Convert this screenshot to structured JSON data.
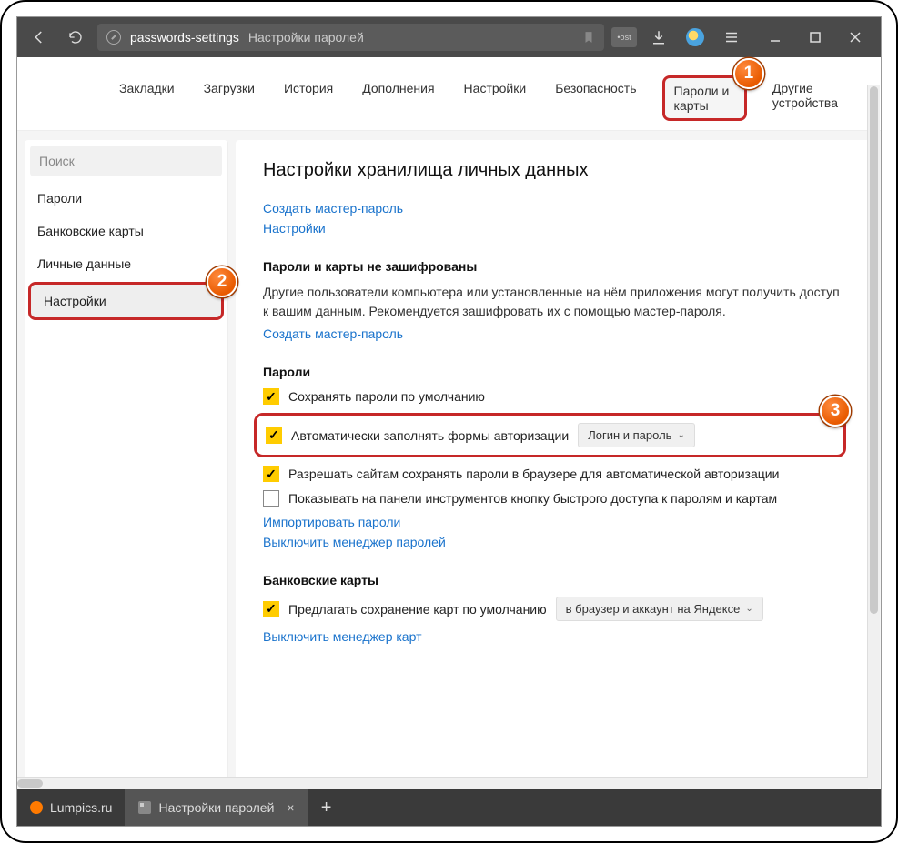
{
  "toolbar": {
    "url": "passwords-settings",
    "page_title": "Настройки паролей"
  },
  "topnav": {
    "items": [
      "Закладки",
      "Загрузки",
      "История",
      "Дополнения",
      "Настройки",
      "Безопасность",
      "Пароли и карты",
      "Другие устройства"
    ],
    "highlighted_index": 6
  },
  "sidebar": {
    "search_placeholder": "Поиск",
    "items": [
      "Пароли",
      "Банковские карты",
      "Личные данные",
      "Настройки"
    ],
    "highlighted_index": 3
  },
  "content": {
    "heading": "Настройки хранилища личных данных",
    "link_create_master": "Создать мастер-пароль",
    "link_settings": "Настройки",
    "enc_section": {
      "title": "Пароли и карты не зашифрованы",
      "desc": "Другие пользователи компьютера или установленные на нём приложения могут получить доступ к вашим данным. Рекомендуется зашифровать их с помощью мастер-пароля.",
      "link": "Создать мастер-пароль"
    },
    "passwords_section": {
      "title": "Пароли",
      "rows": [
        {
          "checked": true,
          "label": "Сохранять пароли по умолчанию"
        },
        {
          "checked": true,
          "label": "Автоматически заполнять формы авторизации",
          "dropdown": "Логин и пароль"
        },
        {
          "checked": true,
          "label": "Разрешать сайтам сохранять пароли в браузере для автоматической авторизации"
        },
        {
          "checked": false,
          "label": "Показывать на панели инструментов кнопку быстрого доступа к паролям и картам"
        }
      ],
      "link_import": "Импортировать пароли",
      "link_disable": "Выключить менеджер паролей"
    },
    "cards_section": {
      "title": "Банковские карты",
      "row": {
        "checked": true,
        "label": "Предлагать сохранение карт по умолчанию",
        "dropdown": "в браузер и аккаунт на Яндексе"
      },
      "link_disable": "Выключить менеджер карт"
    }
  },
  "tabs": {
    "items": [
      {
        "title": "Lumpics.ru",
        "active": false
      },
      {
        "title": "Настройки паролей",
        "active": true
      }
    ]
  },
  "annotations": {
    "b1": "1",
    "b2": "2",
    "b3": "3"
  }
}
